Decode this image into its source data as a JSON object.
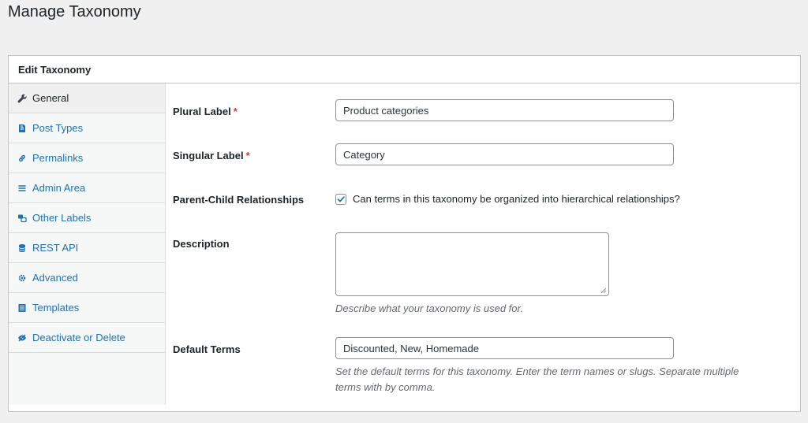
{
  "page_title": "Manage Taxonomy",
  "panel": {
    "header": "Edit Taxonomy"
  },
  "sidebar": {
    "items": [
      {
        "label": "General",
        "icon": "wrench-icon",
        "active": true
      },
      {
        "label": "Post Types",
        "icon": "post-icon",
        "active": false
      },
      {
        "label": "Permalinks",
        "icon": "link-icon",
        "active": false
      },
      {
        "label": "Admin Area",
        "icon": "menu-icon",
        "active": false
      },
      {
        "label": "Other Labels",
        "icon": "labels-icon",
        "active": false
      },
      {
        "label": "REST API",
        "icon": "database-icon",
        "active": false
      },
      {
        "label": "Advanced",
        "icon": "gear-icon",
        "active": false
      },
      {
        "label": "Templates",
        "icon": "template-icon",
        "active": false
      },
      {
        "label": "Deactivate or Delete",
        "icon": "hidden-icon",
        "active": false
      }
    ]
  },
  "form": {
    "plural_label": {
      "label": "Plural Label",
      "required_mark": "*",
      "value": "Product categories"
    },
    "singular_label": {
      "label": "Singular Label",
      "required_mark": "*",
      "value": "Category"
    },
    "parent_child": {
      "label": "Parent-Child Relationships",
      "checked": true,
      "checkbox_text": "Can terms in this taxonomy be organized into hierarchical relationships?"
    },
    "description": {
      "label": "Description",
      "value": "",
      "help": "Describe what your taxonomy is used for."
    },
    "default_terms": {
      "label": "Default Terms",
      "value": "Discounted, New, Homemade",
      "help_line1": "Set the default terms for this taxonomy. Enter the term names or slugs. Separate multiple",
      "help_line2": "terms with by comma."
    }
  },
  "colors": {
    "link": "#2271b1",
    "required": "#d63638",
    "background": "#f0f0f1"
  }
}
